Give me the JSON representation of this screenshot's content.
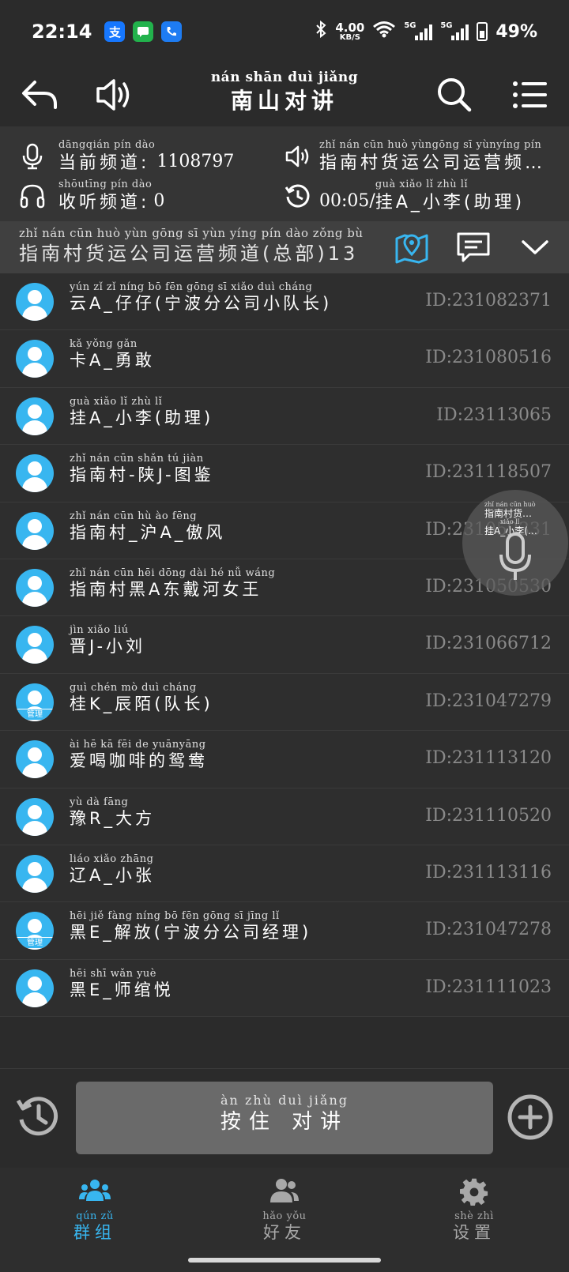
{
  "status_bar": {
    "time": "22:14",
    "net_speed_value": "4.00",
    "net_speed_unit": "KB/S",
    "sim1_tag": "5G",
    "sim2_tag": "5G",
    "battery": "49%",
    "apps": [
      "支",
      "",
      ""
    ]
  },
  "header": {
    "title_pinyin": "nán shān duì jiǎng",
    "title": "南山对讲"
  },
  "info": {
    "current_channel_pinyin": "dāngqián pín dào",
    "current_channel_label": "当前频道:",
    "current_channel_value": "1108797",
    "listen_channel_pinyin": "shōutīng pín dào",
    "listen_channel_label": "收听频道:",
    "listen_channel_value": "0",
    "speaker_channel_pinyin": "zhǐ nán cūn huò yùngōng sī yùnyíng pín",
    "speaker_channel_label": "指南村货运公司运营频…",
    "last_talk_time": "00:05/",
    "last_talk_pinyin": "guà xiǎo lǐ zhù lǐ",
    "last_talk_name": "挂A_小李(助理)"
  },
  "channel_bar": {
    "pinyin": "zhǐ nán cūn huò yùn gōng sī yùn yíng pín dào zǒng bù",
    "name": "指南村货运公司运营频道(总部)13"
  },
  "members": [
    {
      "pinyin": "yún zǐ zǐ níng bō fēn gōng sī xiǎo duì cháng",
      "name": "云A_仔仔(宁波分公司小队长)",
      "id": "ID:231082371",
      "badge": ""
    },
    {
      "pinyin": "kǎ yǒng gǎn",
      "name": "卡A_勇敢",
      "id": "ID:231080516",
      "badge": ""
    },
    {
      "pinyin": "guà xiǎo lǐ zhù lǐ",
      "name": "挂A_小李(助理)",
      "id": "ID:23113065",
      "badge": ""
    },
    {
      "pinyin": "zhǐ nán cūn shǎn tú jiàn",
      "name": "指南村-陕J-图鉴",
      "id": "ID:231118507",
      "badge": ""
    },
    {
      "pinyin": "zhǐ nán cūn hù ào fēng",
      "name": "指南村_沪A_傲风",
      "id": "ID:231059331",
      "badge": ""
    },
    {
      "pinyin": "zhǐ nán cūn hēi dōng dài hé nǚ wáng",
      "name": "指南村黑A东戴河女王",
      "id": "ID:231050530",
      "badge": ""
    },
    {
      "pinyin": "jìn xiǎo liú",
      "name": "晋J-小刘",
      "id": "ID:231066712",
      "badge": ""
    },
    {
      "pinyin": "guì chén mò duì cháng",
      "name": "桂K_辰陌(队长)",
      "id": "ID:231047279",
      "badge": "管理"
    },
    {
      "pinyin": "ài hē kā fēi de yuānyāng",
      "name": "爱喝咖啡的鸳鸯",
      "id": "ID:231113120",
      "badge": ""
    },
    {
      "pinyin": "yù dà fāng",
      "name": "豫R_大方",
      "id": "ID:231110520",
      "badge": ""
    },
    {
      "pinyin": "liáo xiǎo zhāng",
      "name": "辽A_小张",
      "id": "ID:231113116",
      "badge": ""
    },
    {
      "pinyin": "hēi jiě fàng níng bō fēn gōng sī jīng lǐ",
      "name": "黑E_解放(宁波分公司经理)",
      "id": "ID:231047278",
      "badge": "管理"
    },
    {
      "pinyin": "hēi shī wǎn yuè",
      "name": "黑E_师绾悦",
      "id": "ID:231111023",
      "badge": ""
    }
  ],
  "floating_mic": {
    "pinyin": "zhǐ nán cūn huò",
    "channel": "指南村货…",
    "pinyin2": "xiǎo lǐ",
    "speaker": "挂A_小李(…"
  },
  "talk": {
    "pinyin": "àn zhù duì jiǎng",
    "label": "按住 对讲"
  },
  "nav": {
    "groups_pinyin": "qún zǔ",
    "groups": "群组",
    "friends_pinyin": "hǎo yǒu",
    "friends": "好友",
    "settings_pinyin": "shè zhì",
    "settings": "设置"
  },
  "colors": {
    "accent": "#38b6f0",
    "background": "#2b2b2b",
    "id_text": "#8a8a8a"
  }
}
